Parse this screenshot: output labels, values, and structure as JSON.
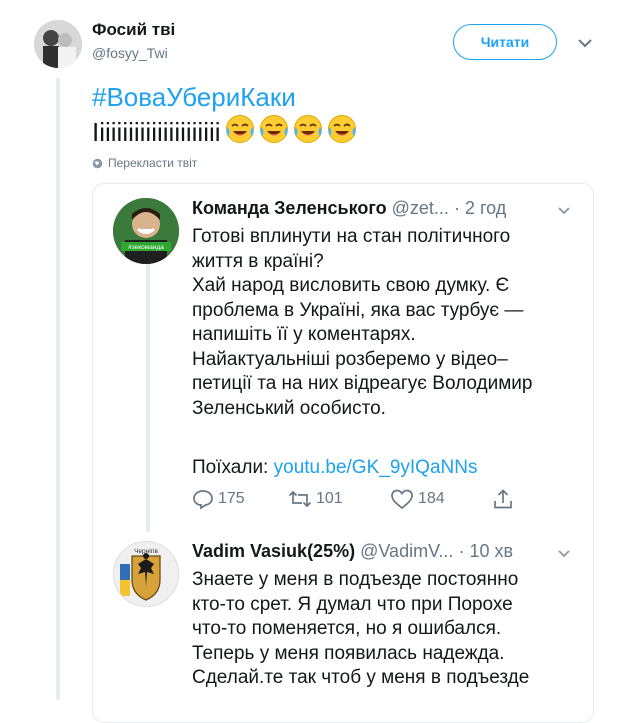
{
  "header": {
    "author_name": "Фосий тві",
    "author_handle": "@fosyy_Twi",
    "follow_label": "Читати"
  },
  "tweet": {
    "hashtag": "#ВоваУбериКаки",
    "body_text": "Іііііііііііііііііііііі",
    "emoji_icons": [
      "face-with-tears-of-joy-icon",
      "face-with-tears-of-joy-icon",
      "face-with-tears-of-joy-icon",
      "face-with-tears-of-joy-icon"
    ],
    "translate_label": "Перекласти твіт"
  },
  "quoted": [
    {
      "name": "Команда Зеленського",
      "handle": "@zet...",
      "time": "· 2 год",
      "avatar_badge": "#зекоманда",
      "lines": [
        "Готові вплинути на стан політичного",
        "життя в країні?",
        "Хай народ висловить свою думку. Є",
        "проблема в Україні, яка вас турбує —",
        "напишіть її у коментарях.",
        "Найактуальніші розберемо у відео–",
        "петиції та на них відреагує Володимир",
        "Зеленський особисто."
      ],
      "cta_prefix": "Поїхали: ",
      "link": "youtu.be/GK_9yIQaNNs",
      "replies": "175",
      "retweets": "101",
      "likes": "184"
    },
    {
      "name": "Vadim Vasiuk(25%)",
      "handle": "@VadimV...",
      "time": "· 10 хв",
      "avatar_caption": "Чернігів",
      "lines": [
        "Знаете у меня в подъезде постоянно",
        "кто-то срет. Я думал что при Порохе",
        "что-то поменяется, но я ошибался.",
        "Теперь у меня появилась надежда.",
        "Сделай.те так чтоб у меня в подъезде"
      ]
    }
  ],
  "colors": {
    "accent": "#1da1f2",
    "muted": "#657786",
    "text": "#14171a",
    "border": "#e6ecf0",
    "emoji_yellow": "#ffcc33"
  }
}
